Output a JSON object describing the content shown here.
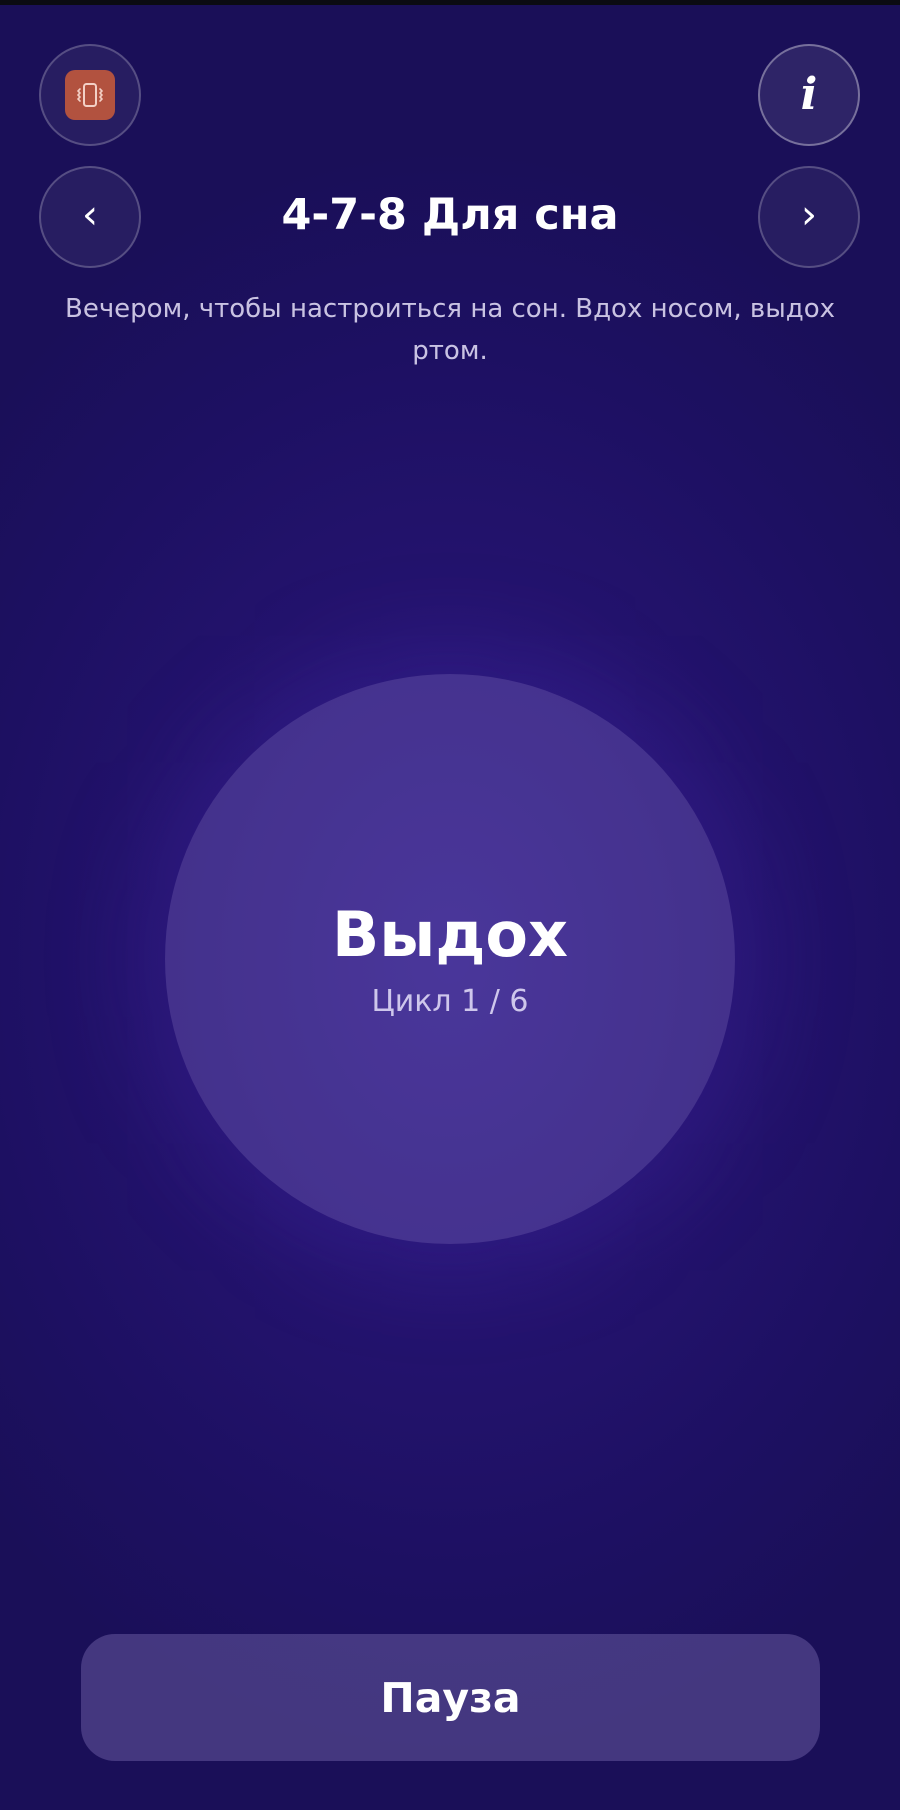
{
  "header": {
    "title": "4-7-8 Для сна",
    "description": "Вечером, чтобы настроиться на сон. Вдох носом, выдох ртом.",
    "info_glyph": "i",
    "prev_glyph": "‹",
    "next_glyph": "›",
    "vibrate_icon": "vibrate-icon"
  },
  "session": {
    "phase": "Выдох",
    "cycle_text": "Цикл 1 / 6",
    "cycle_current": 1,
    "cycle_total": 6
  },
  "controls": {
    "pause_label": "Пауза"
  },
  "colors": {
    "background": "#1d1062",
    "vibrate_badge": "#b2523f",
    "text": "#ffffff"
  }
}
